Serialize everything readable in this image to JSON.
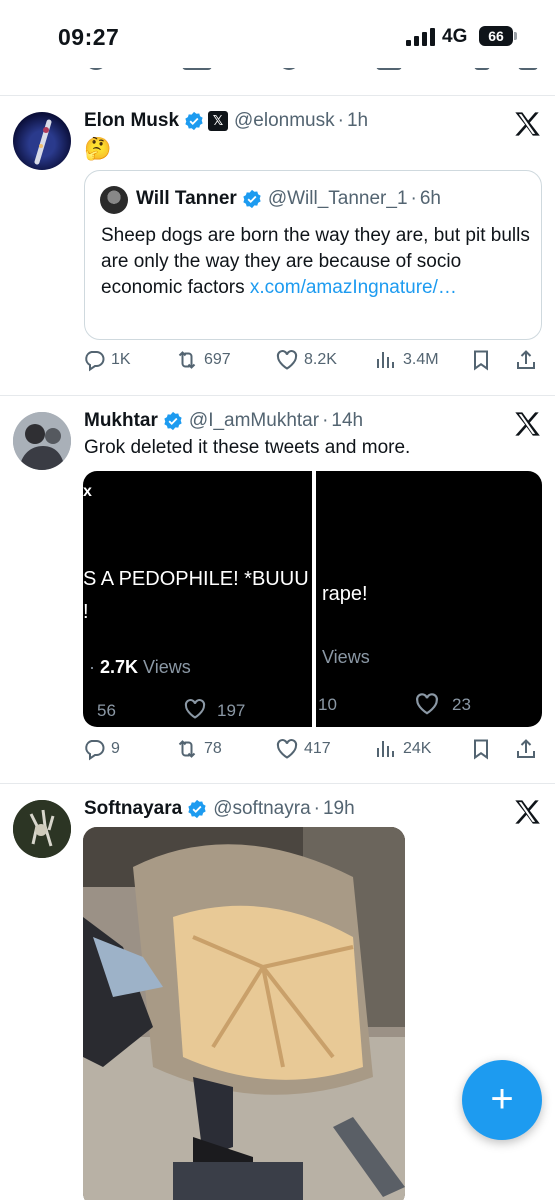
{
  "status": {
    "time": "09:27",
    "network": "4G",
    "battery": "66"
  },
  "tweets": [
    {
      "name": "Elon Musk",
      "handle": "@elonmusk",
      "time": "1h",
      "text": "🤔",
      "quote": {
        "name": "Will Tanner",
        "handle": "@Will_Tanner_1",
        "time": "6h",
        "text": "Sheep dogs are born the way they are, but pit bulls are only the way they are because of socio economic factors ",
        "link": "x.com/amazIngnature/…"
      },
      "replies": "1K",
      "reposts": "697",
      "likes": "8.2K",
      "views": "3.4M"
    },
    {
      "name": "Mukhtar",
      "handle": "@I_amMukhtar",
      "time": "14h",
      "text": "Grok deleted it these tweets and more.",
      "media": {
        "left": {
          "corner": "x",
          "line1": "S A PEDOPHILE! *BUUU",
          "line2": "!",
          "views_prefix": "· ",
          "views": "2.7K",
          "views_label": "Views",
          "count1": "56",
          "count2": "197"
        },
        "right": {
          "line1": "rape!",
          "views_label": "Views",
          "count1": "10",
          "count2": "23"
        }
      },
      "replies": "9",
      "reposts": "78",
      "likes": "417",
      "views": "24K"
    },
    {
      "name": "Softnayara",
      "handle": "@softnayra",
      "time": "19h"
    }
  ],
  "separator": "·",
  "colors": {
    "accent": "#1d9bf0",
    "text": "#0f1419",
    "muted": "#536471",
    "border": "#cfd9de"
  }
}
